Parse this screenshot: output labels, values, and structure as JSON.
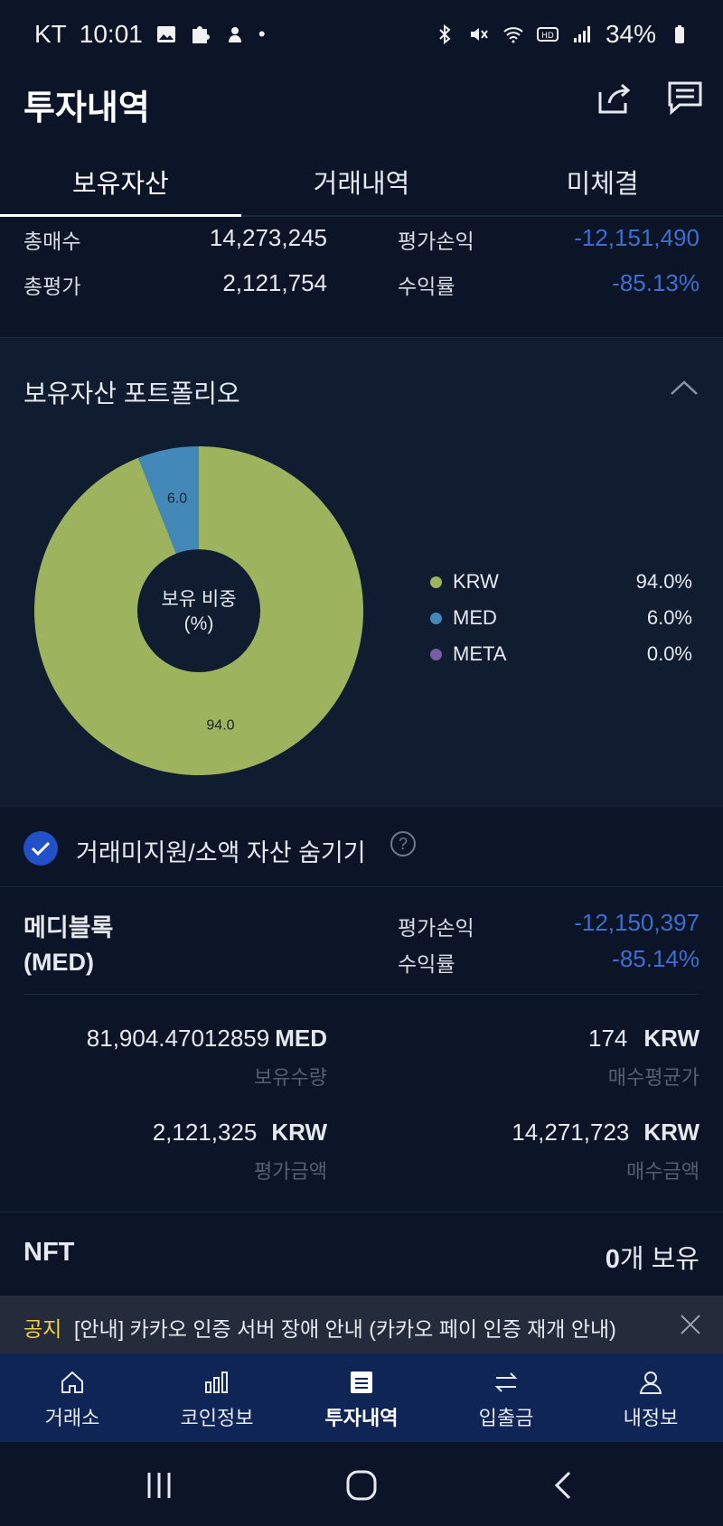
{
  "status_bar": {
    "carrier": "KT",
    "time": "10:01",
    "battery": "34%"
  },
  "header": {
    "title": "투자내역"
  },
  "tabs": [
    {
      "label": "보유자산",
      "active": true
    },
    {
      "label": "거래내역",
      "active": false
    },
    {
      "label": "미체결",
      "active": false
    }
  ],
  "summary": {
    "total_buy_label": "총매수",
    "total_buy": "14,273,245",
    "total_eval_label": "총평가",
    "total_eval": "2,121,754",
    "pnl_label": "평가손익",
    "pnl": "-12,151,490",
    "return_label": "수익률",
    "return": "-85.13%"
  },
  "portfolio": {
    "title": "보유자산 포트폴리오",
    "center_label_1": "보유 비중",
    "center_label_2": "(%)"
  },
  "chart_data": {
    "type": "pie",
    "categories": [
      "KRW",
      "MED",
      "META"
    ],
    "values": [
      94.0,
      6.0,
      0.0
    ],
    "slice_labels": [
      "94.0",
      "6.0"
    ],
    "legend_values": [
      "94.0%",
      "6.0%",
      "0.0%"
    ],
    "colors": [
      "#9db35e",
      "#4288b9",
      "#7a5ba8"
    ],
    "legend": "right"
  },
  "hide_small": {
    "label": "거래미지원/소액 자산 숨기기",
    "checked": true,
    "help": "?"
  },
  "asset": {
    "name_line1": "메디블록",
    "name_line2": "(MED)",
    "pnl_label": "평가손익",
    "pnl": "-12,150,397",
    "return_label": "수익률",
    "return": "-85.14%",
    "holding_qty": "81,904.47012859",
    "holding_unit": "MED",
    "holding_label": "보유수량",
    "avg_price": "174",
    "avg_unit": "KRW",
    "avg_label": "매수평균가",
    "eval_amount": "2,121,325",
    "eval_unit": "KRW",
    "eval_label": "평가금액",
    "buy_amount": "14,271,723",
    "buy_unit": "KRW",
    "buy_label": "매수금액"
  },
  "nft": {
    "label": "NFT",
    "count": "0",
    "suffix": "개 보유"
  },
  "notice": {
    "tag": "공지",
    "text": "[안내] 카카오 인증 서버 장애 안내 (카카오 페이 인증 재개 안내)"
  },
  "bottom_nav": [
    {
      "label": "거래소",
      "icon": "home-icon"
    },
    {
      "label": "코인정보",
      "icon": "bar-chart-icon"
    },
    {
      "label": "투자내역",
      "icon": "document-icon",
      "active": true
    },
    {
      "label": "입출금",
      "icon": "transfer-icon"
    },
    {
      "label": "내정보",
      "icon": "user-icon"
    }
  ]
}
